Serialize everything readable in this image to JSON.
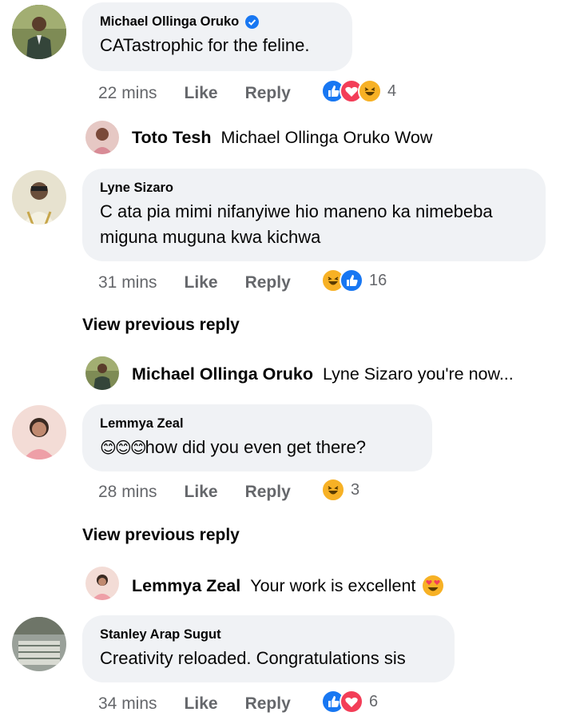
{
  "comments": [
    {
      "author": "Michael Ollinga Oruko",
      "text": "CATastrophic for the feline.",
      "time": "22 mins",
      "like_label": "Like",
      "reply_label": "Reply",
      "reaction_icons": [
        "like-icon",
        "love-icon",
        "haha-icon"
      ],
      "reaction_count": "4",
      "verified": true,
      "avatar_color": "#4a5a3a"
    },
    {
      "author": "Lyne Sizaro",
      "text": "C ata pia mimi nifanyiwe hio maneno ka nimebeba miguna muguna kwa kichwa",
      "time": "31 mins",
      "like_label": "Like",
      "reply_label": "Reply",
      "reaction_icons": [
        "haha-icon",
        "like-icon"
      ],
      "reaction_count": "16",
      "avatar_color": "#d9d0b8"
    },
    {
      "author": "Lemmya Zeal",
      "text": "how did you even get there?",
      "emoji_prefix": "😊😊😊",
      "time": "28 mins",
      "like_label": "Like",
      "reply_label": "Reply",
      "reaction_icons": [
        "haha-icon"
      ],
      "reaction_count": "3",
      "avatar_color": "#e9b9b0"
    },
    {
      "author": "Stanley Arap Sugut",
      "text": "Creativity reloaded. Congratulations sis",
      "time": "34 mins",
      "like_label": "Like",
      "reply_label": "Reply",
      "reaction_icons": [
        "like-icon",
        "love-icon"
      ],
      "reaction_count": "6",
      "avatar_color": "#8a8f86"
    }
  ],
  "replies": [
    {
      "author": "Toto Tesh",
      "text": "Michael Ollinga Oruko Wow",
      "avatar_color": "#d99aa0"
    },
    {
      "author": "Michael Ollinga Oruko",
      "text": "Lyne Sizaro you're now...",
      "avatar_color": "#4a5a3a"
    },
    {
      "author": "Lemmya Zeal",
      "text": "Your work is excellent",
      "trailing_emoji": "heart-eyes-icon",
      "avatar_color": "#e9b9b0"
    }
  ],
  "view_previous_reply": "View previous reply",
  "colors": {
    "bubble": "#f0f2f5",
    "meta_text": "#65676b",
    "like_blue": "#1877f2",
    "love_red": "#f33e58",
    "haha_yellow": "#f7b125",
    "verified_blue": "#1877f2"
  }
}
